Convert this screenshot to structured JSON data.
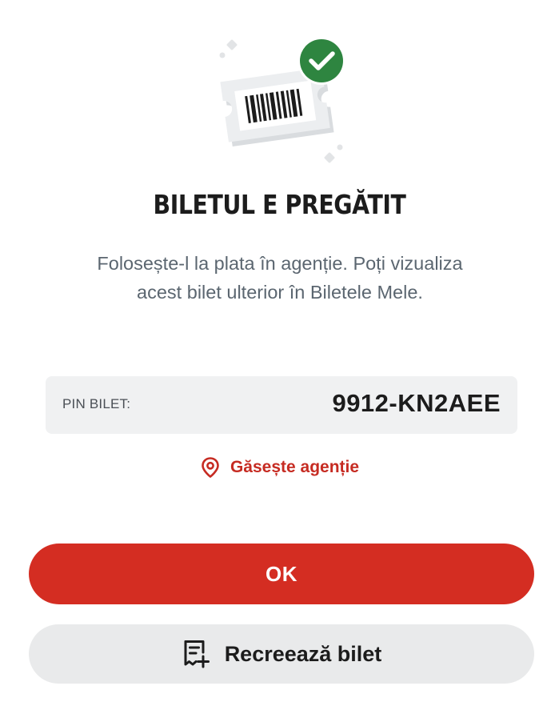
{
  "header": {
    "illustration_icon": "ticket-barcode-check-illustration",
    "title": "BILETUL E PREGĂTIT",
    "subtitle_line1": "Folosește-l la plata în agenție. Poți vizualiza",
    "subtitle_line2": "acest bilet ulterior în Biletele Mele."
  },
  "pin": {
    "label": "PIN BILET:",
    "value": "9912-KN2AEE"
  },
  "find_agency": {
    "icon": "location-pin-icon",
    "label": "Găsește agenție"
  },
  "actions": {
    "ok_label": "OK",
    "recreate_icon": "receipt-add-icon",
    "recreate_label": "Recreează bilet"
  },
  "colors": {
    "accent_red": "#d42d22",
    "link_red": "#c62b22",
    "check_green": "#2e8540",
    "neutral_bg": "#f0f1f2",
    "secondary_button_bg": "#e9eaeb",
    "subtitle_gray": "#5b6670"
  }
}
